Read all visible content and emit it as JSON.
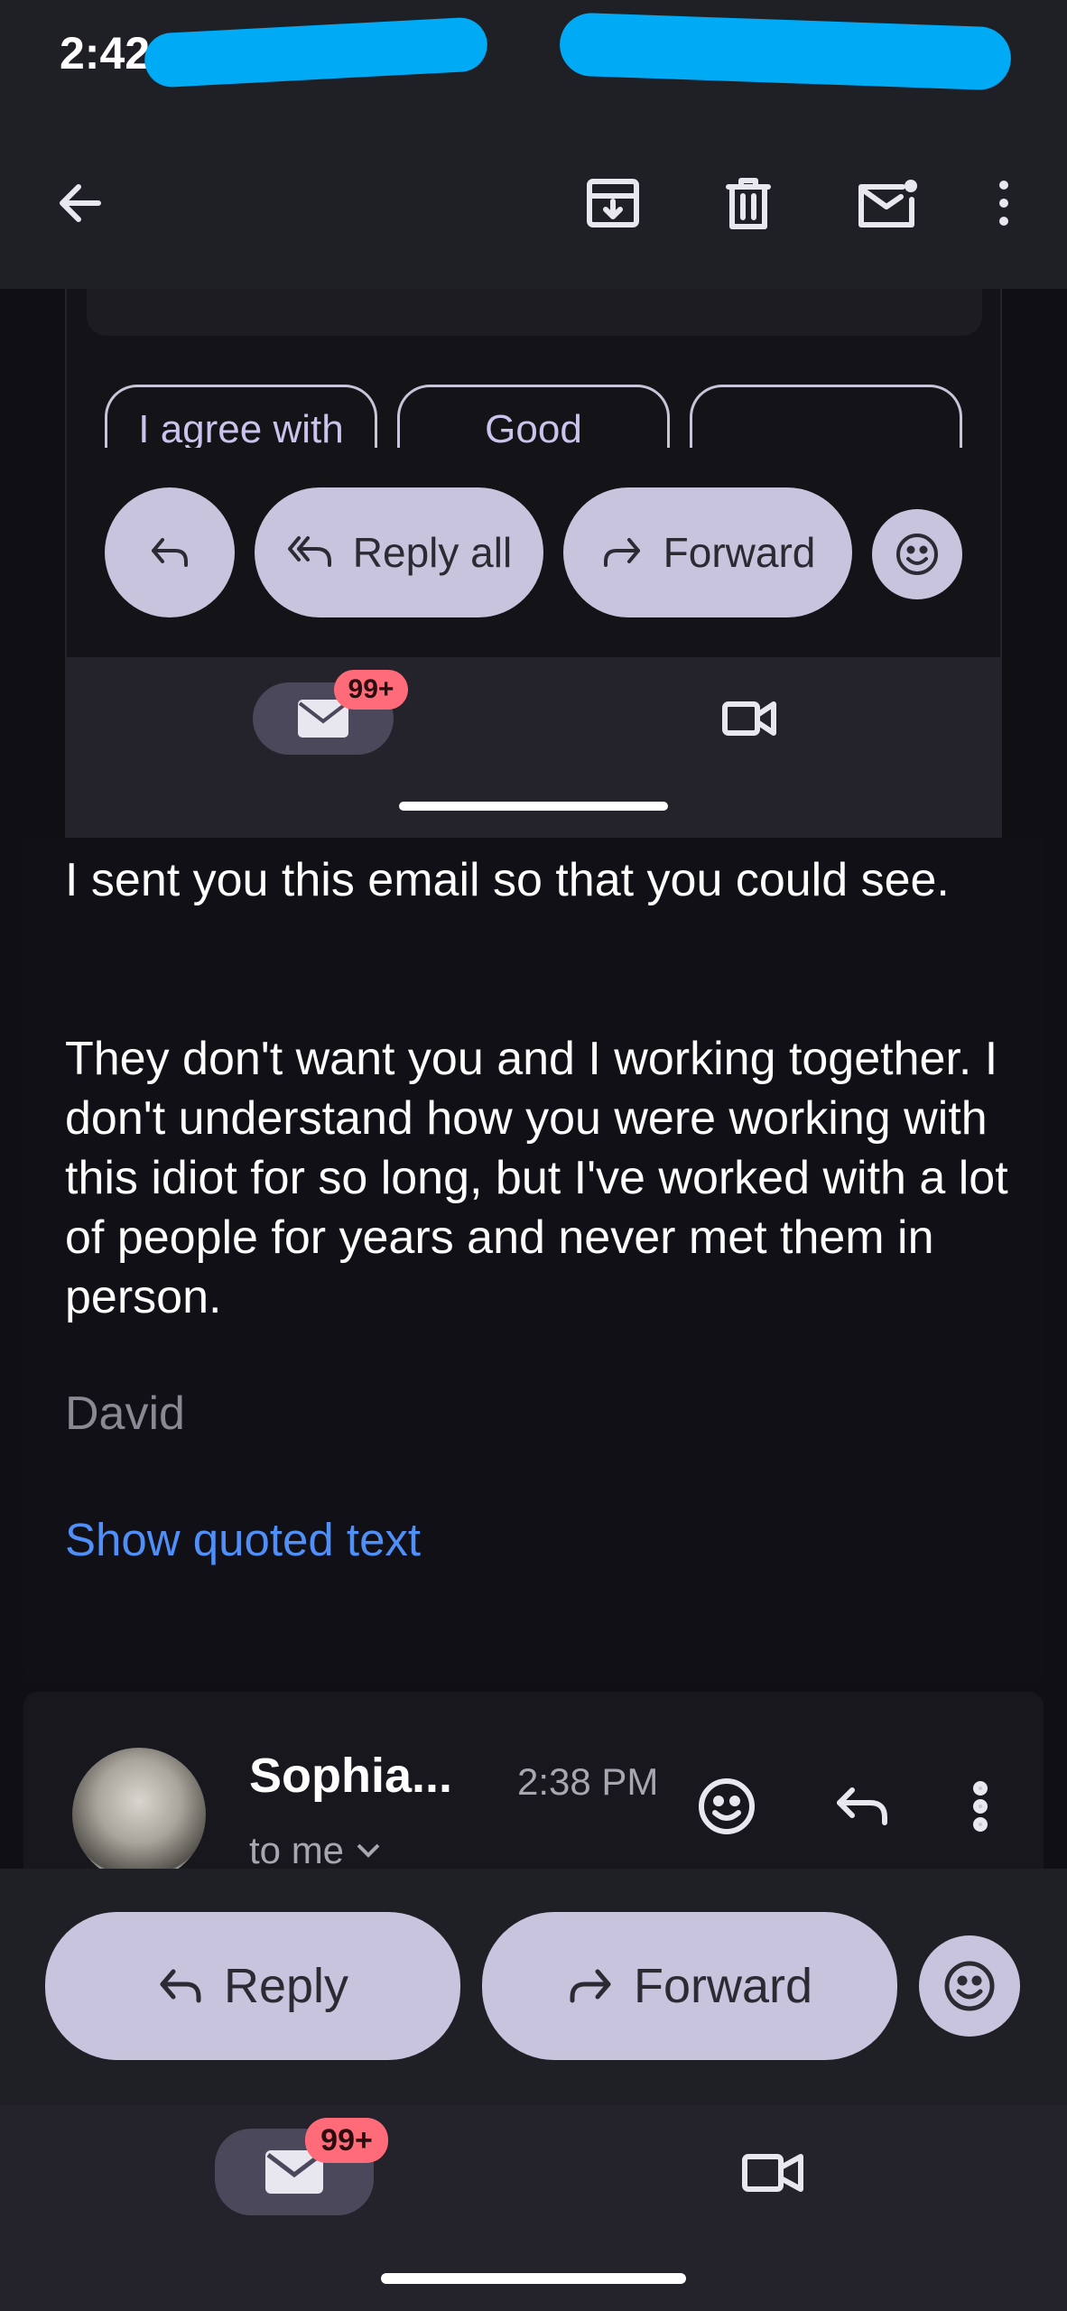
{
  "status_bar": {
    "time": "2:42"
  },
  "toolbar": {
    "icons": [
      "back-arrow-icon",
      "archive-icon",
      "delete-icon",
      "mark-unread-icon",
      "more-vert-icon"
    ]
  },
  "panel": {
    "smart_replies": [
      "I agree with",
      "Good",
      ""
    ],
    "reply_all_label": "Reply all",
    "forward_label": "Forward",
    "nav_badge": "99+"
  },
  "email": {
    "paragraph1": "I sent you this email so that you could see.",
    "paragraph2": "They don't want you and I working together. I don't understand how you were working with this idiot for so long, but I've worked with a lot of people for years and never met them in person.",
    "signature": "David",
    "show_quoted": "Show quoted text"
  },
  "message2": {
    "sender": "Sophia...",
    "time": "2:38 PM",
    "recipient": "to me"
  },
  "actions": {
    "reply_label": "Reply",
    "forward_label": "Forward"
  },
  "bottom_nav": {
    "mail_badge": "99+"
  },
  "colors": {
    "accent_link": "#4f8ff7",
    "pill_bg": "#c9c4dd",
    "badge_bg": "#ff6b78",
    "redaction": "#00aaf5"
  }
}
